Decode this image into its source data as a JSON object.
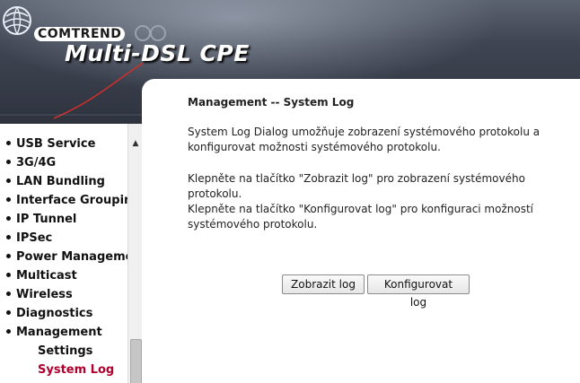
{
  "header": {
    "brand": "COMTREND",
    "product": "Multi-DSL CPE"
  },
  "sidebar": {
    "items": [
      {
        "label": "USB Service",
        "level": 0
      },
      {
        "label": "3G/4G",
        "level": 0
      },
      {
        "label": "LAN Bundling",
        "level": 0
      },
      {
        "label": "Interface Grouping",
        "level": 0
      },
      {
        "label": "IP Tunnel",
        "level": 0
      },
      {
        "label": "IPSec",
        "level": 0
      },
      {
        "label": "Power Management",
        "level": 0
      },
      {
        "label": "Multicast",
        "level": 0
      },
      {
        "label": "Wireless",
        "level": 0
      },
      {
        "label": "Diagnostics",
        "level": 0
      },
      {
        "label": "Management",
        "level": 0
      },
      {
        "label": "Settings",
        "level": 1
      },
      {
        "label": "System Log",
        "level": 1,
        "active": true
      }
    ]
  },
  "main": {
    "title": "Management -- System Log",
    "para1": "System Log Dialog umožňuje zobrazení systémového protokolu a konfigurovat možnosti systémového protokolu.",
    "para2": "Klepněte na tlačítko \"Zobrazit log\" pro zobrazení systémového protokolu.",
    "para3": "Klepněte na tlačítko \"Konfigurovat log\" pro konfiguraci možností systémového protokolu.",
    "buttons": {
      "show_log": "Zobrazit log",
      "configure_log": "Konfigurovat log"
    }
  },
  "colors": {
    "active_nav": "#b0002e",
    "header_dark": "#2e333e"
  }
}
